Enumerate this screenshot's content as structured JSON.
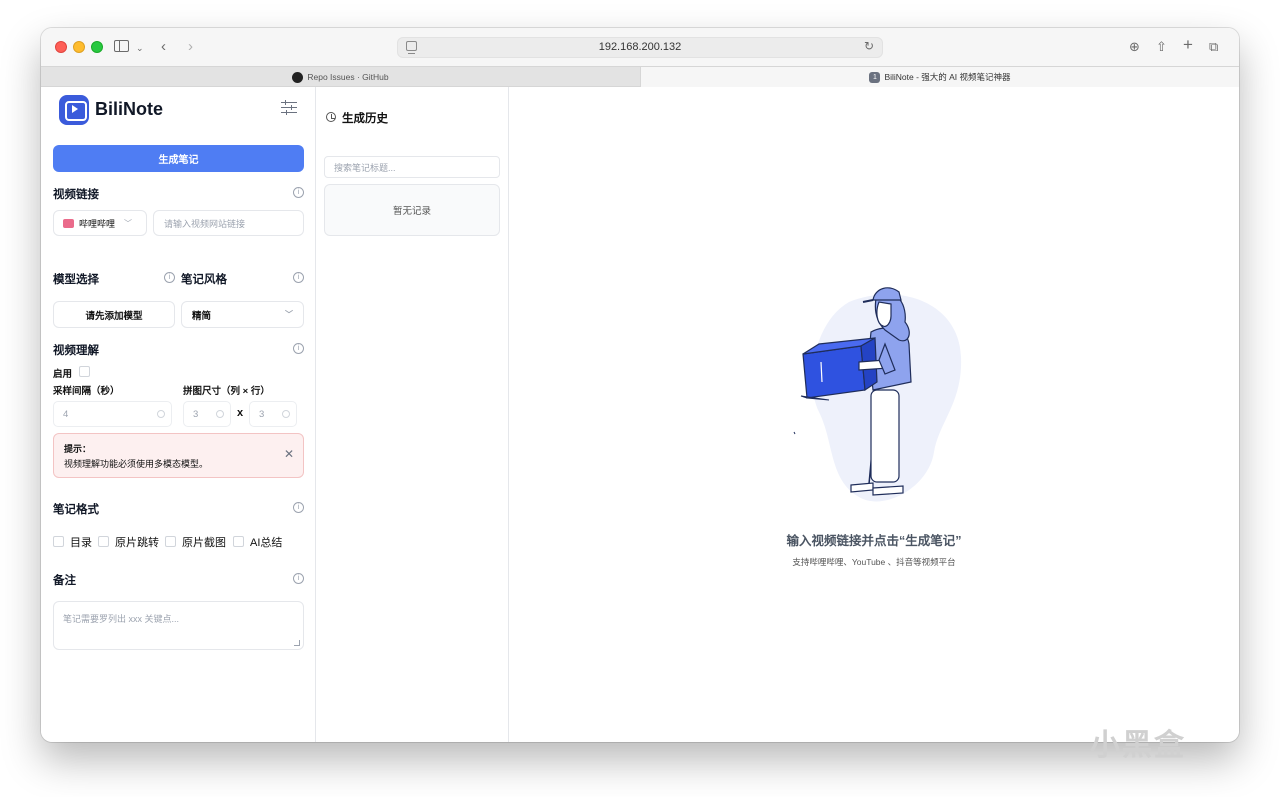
{
  "browser": {
    "address": "192.168.200.132",
    "tabs": [
      {
        "label": "Repo Issues · GitHub"
      },
      {
        "label": "BiliNote - 强大的 AI 视频笔记神器",
        "badge": "1"
      }
    ]
  },
  "sidebar": {
    "brand": "BiliNote",
    "generate_label": "生成笔记",
    "video_link_label": "视频链接",
    "platform_value": "哔哩哔哩",
    "url_placeholder": "请输入视频网站链接",
    "model_label": "模型选择",
    "style_label": "笔记风格",
    "model_button": "请先添加模型",
    "style_value": "精简",
    "understanding_label": "视频理解",
    "enable_label": "启用",
    "interval_label": "采样间隔（秒）",
    "grid_label": "拼图尺寸（列 × 行）",
    "interval_value": "4",
    "grid_cols": "3",
    "grid_rows": "3",
    "times": "x",
    "alert_title": "提示：",
    "alert_text": "视频理解功能必须使用多模态模型。",
    "format_label": "笔记格式",
    "format_options": [
      "目录",
      "原片跳转",
      "原片截图",
      "AI总结"
    ],
    "remark_label": "备注",
    "remark_placeholder": "笔记需要罗列出 xxx 关键点..."
  },
  "history": {
    "title": "生成历史",
    "search_placeholder": "搜索笔记标题...",
    "empty_text": "暂无记录"
  },
  "main": {
    "empty_title": "输入视频链接并点击“生成笔记”",
    "empty_subtitle": "支持哔哩哔哩、YouTube 、抖音等视频平台"
  },
  "watermark": "小黑盒",
  "colors": {
    "primary": "#4f7df3",
    "box_blue": "#2f52e0",
    "alert_bg": "#fdf0f0"
  }
}
